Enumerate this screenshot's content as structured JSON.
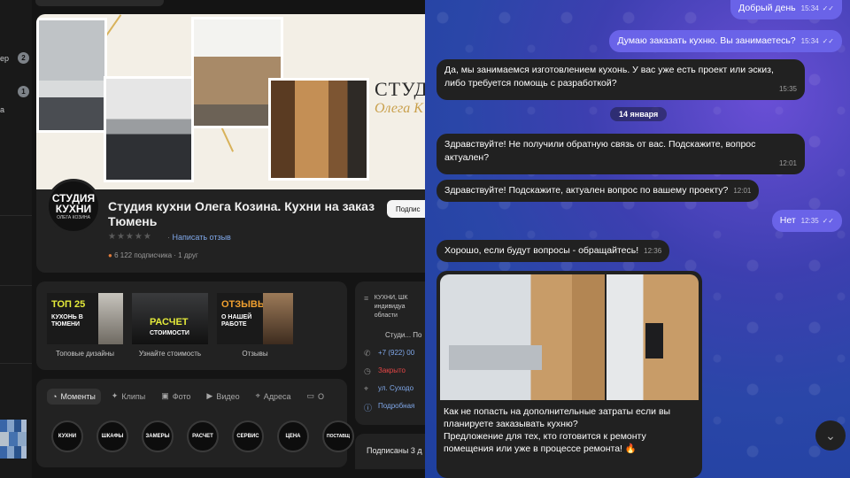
{
  "left_panel": {
    "sidebar": {
      "items": [
        {
          "label": "ер",
          "count": "2"
        },
        {
          "label": "",
          "count": "1"
        },
        {
          "label": "а",
          "count": ""
        }
      ]
    },
    "group": {
      "cover_brand_line1": "СТУД",
      "cover_brand_line2": "Олега К",
      "logo_line1": "СТУДИЯ",
      "logo_line2": "КУХНИ",
      "logo_line3": "ОЛЕГА КОЗИНА",
      "name": "Студия кухни Олега Козина. Кухни на заказ Тюмень",
      "stars": "★★★★★",
      "write_review": "Написать отзыв",
      "subscribers": "6 122 подписчика · 1 друг",
      "subscribe_button": "Подпис"
    },
    "highlights": [
      {
        "title": "ТОП 25",
        "sub": "КУХОНЬ В ТЮМЕНИ",
        "label": "Топовые дизайны"
      },
      {
        "title": "РАСЧЕТ",
        "sub": "СТОИМОСТИ",
        "label": "Узнайте стоимость"
      },
      {
        "title": "ОТЗЫВЫ",
        "sub": "О НАШЕЙ РАБОТЕ",
        "label": "Отзывы"
      }
    ],
    "tabs": [
      {
        "label": "Моменты",
        "icon": "moments-icon",
        "active": true
      },
      {
        "label": "Клипы",
        "icon": "clips-icon"
      },
      {
        "label": "Фото",
        "icon": "photo-icon"
      },
      {
        "label": "Видео",
        "icon": "video-icon"
      },
      {
        "label": "Адреса",
        "icon": "pin-icon"
      },
      {
        "label": "О",
        "icon": "chat-icon"
      }
    ],
    "stories": [
      "КУХНИ",
      "ШКАФЫ",
      "ЗАМЕРЫ",
      "РАСЧЕТ",
      "СЕРВИС",
      "ЦЕНА",
      "ПОСТАВЩ"
    ],
    "info": {
      "desc": "КУХНИ, ШК индивидуа области",
      "studio_link": "Студи... По",
      "phone": "+7 (922) 00",
      "status": "Закрыто",
      "address": "ул. Суходо",
      "more": "Подробная",
      "subscribed_label": "Подписаны 3 д"
    }
  },
  "chat": {
    "date_divider": "14 января",
    "messages": [
      {
        "dir": "out",
        "text": "Добрый день",
        "time": "15:34"
      },
      {
        "dir": "out",
        "text": "Думаю заказать кухню. Вы занимаетесь?",
        "time": "15:34"
      },
      {
        "dir": "in",
        "text": "Да, мы занимаемся изготовлением кухонь. У вас уже есть проект или эскиз, либо требуется помощь с разработкой?",
        "time": "15:35"
      },
      {
        "dir": "in",
        "text": "Здравствуйте! Не получили обратную связь от вас. Подскажите, вопрос актуален?",
        "time": "12:01"
      },
      {
        "dir": "in",
        "text": "Здравствуйте! Подскажите, актуален вопрос по вашему проекту?",
        "time": "12:01"
      },
      {
        "dir": "out",
        "text": "Нет",
        "time": "12:35"
      },
      {
        "dir": "in",
        "text": "Хорошо, если будут вопросы - обращайтесь!",
        "time": "12:36"
      }
    ],
    "media_caption": "Как не попасть на дополнительные затраты если вы планируете заказывать кухню?\nПредложение для тех, кто готовится к ремонту помещения или уже в процессе ремонта! 🔥",
    "read_mark": "✓✓",
    "scroll_icon": "chevron-down-icon"
  }
}
